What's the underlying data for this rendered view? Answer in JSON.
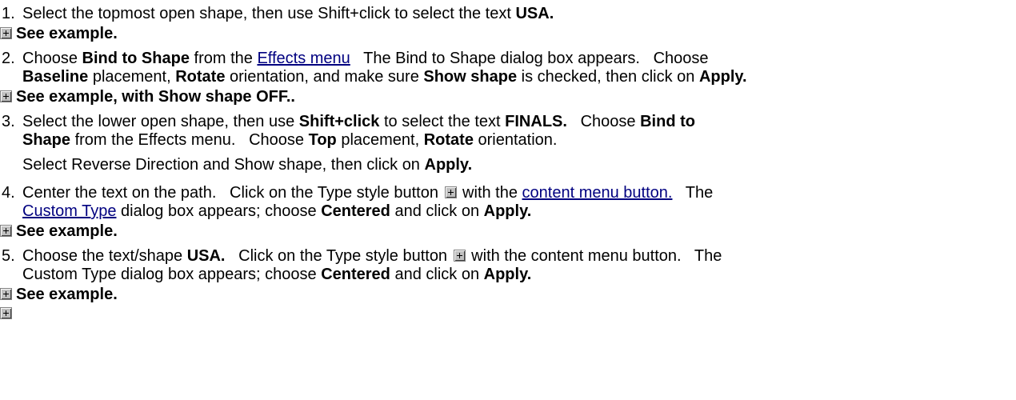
{
  "steps": [
    {
      "number": "1.",
      "lines": [
        {
          "t1": "Select the topmost open shape, then use Shift+click to select the text ",
          "b1": "USA."
        }
      ],
      "example": "See example."
    },
    {
      "number": "2.",
      "lines": [
        {
          "t1": "Choose ",
          "b1": "Bind to Shape",
          "t2": " from the ",
          "link": "Effects menu",
          "t3": "   The Bind to Shape dialog box appears.   Choose"
        },
        {
          "b1": "Baseline",
          "t1": " placement, ",
          "b2": "Rotate",
          "t2": " orientation, and make sure ",
          "b3": "Show shape",
          "t3": " is checked, then click on ",
          "b4": "Apply."
        }
      ],
      "example": "See example, with Show shape OFF.."
    },
    {
      "number": "3.",
      "lines": [
        {
          "t1": "Select the lower open shape, then use ",
          "b1": "Shift+click",
          "t2": " to select the text ",
          "b2": "FINALS.",
          "t3": "   Choose ",
          "b3": "Bind to"
        },
        {
          "b1": "Shape",
          "t1": " from the Effects menu.   Choose ",
          "b2": "Top",
          "t2": " placement, ",
          "b3": "Rotate",
          "t3": " orientation."
        },
        {
          "t1": "Select Reverse Direction and Show shape, then click on ",
          "b1": "Apply."
        }
      ]
    },
    {
      "number": "4.",
      "lines": [
        {
          "t1": "Center the text on the path.   Click on the Type style button ",
          "t2": " with the ",
          "link": "content menu button.",
          "t3": "   The"
        },
        {
          "link": "Custom Type",
          "t1": " dialog box appears; choose ",
          "b1": "Centered",
          "t2": " and click on ",
          "b2": "Apply."
        }
      ],
      "example": "See example."
    },
    {
      "number": "5.",
      "lines": [
        {
          "t1": "Choose the text/shape ",
          "b1": "USA.",
          "t2": "   Click on the Type style button ",
          "t3": " with the content menu button.   The"
        },
        {
          "t1": "Custom Type dialog box appears; choose ",
          "b1": "Centered",
          "t2": " and click on ",
          "b2": "Apply."
        }
      ],
      "example": "See example."
    }
  ]
}
